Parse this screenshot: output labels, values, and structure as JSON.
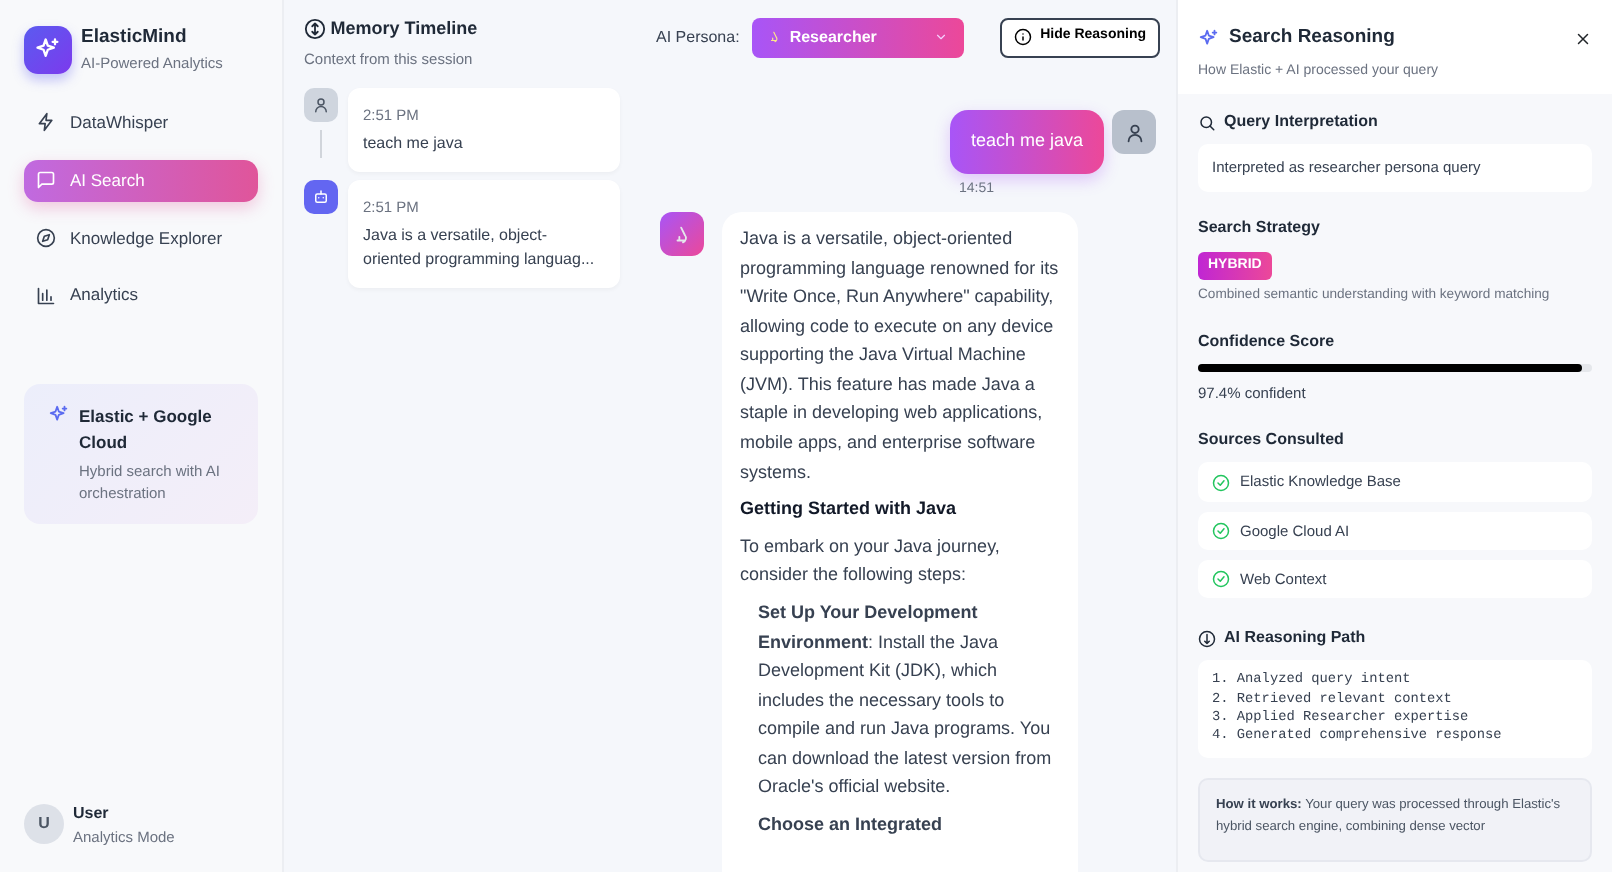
{
  "brand": {
    "name": "ElasticMind",
    "subtitle": "AI-Powered Analytics"
  },
  "nav": [
    {
      "label": "DataWhisper",
      "selected": false
    },
    {
      "label": "AI Search",
      "selected": true
    },
    {
      "label": "Knowledge Explorer",
      "selected": false
    },
    {
      "label": "Analytics",
      "selected": false
    }
  ],
  "promo": {
    "title": "Elastic + Google Cloud",
    "text": "Hybrid search with AI orchestration"
  },
  "user": {
    "initial": "U",
    "name": "User",
    "mode": "Analytics Mode"
  },
  "memory": {
    "title": "Memory Timeline",
    "subtitle": "Context from this session",
    "entries": [
      {
        "kind": "user",
        "time": "2:51 PM",
        "text": "teach me java"
      },
      {
        "kind": "assistant",
        "time": "2:51 PM",
        "text": "Java is a versatile, object-oriented programming languag..."
      }
    ]
  },
  "chat_header": {
    "persona_label": "AI Persona:",
    "persona_value": "Researcher",
    "hide_button": "Hide Reasoning"
  },
  "user_message": {
    "text": "teach me java",
    "time": "14:51"
  },
  "assistant_message": {
    "blocks": [
      {
        "kind": "p",
        "text": "Java is a versatile, object-oriented programming language renowned for its \"Write Once, Run Anywhere\" capability, allowing code to execute on any device supporting the Java Virtual Machine (JVM). This feature has made Java a staple in developing web applications, mobile apps, and enterprise software systems."
      },
      {
        "kind": "h",
        "text": "Getting Started with Java"
      },
      {
        "kind": "p",
        "text": "To embark on your Java journey, consider the following steps:"
      },
      {
        "kind": "li",
        "text": "**Set Up Your Development Environment**: Install the Java Development Kit (JDK), which includes the necessary tools to compile and run Java programs. You can download the latest version from Oracle's official website."
      },
      {
        "kind": "lih",
        "text": "Choose an Integrated"
      }
    ]
  },
  "reasoning": {
    "title": "Search Reasoning",
    "subtitle": "How Elastic + AI processed your query",
    "query_title": "Query Interpretation",
    "query_text": "Interpreted as researcher persona query",
    "strategy_title": "Search Strategy",
    "strategy_badge": "HYBRID",
    "strategy_text": "Combined semantic understanding with keyword matching",
    "confidence_title": "Confidence Score",
    "confidence": {
      "level": 0.974
    },
    "confidence_text": "97.4% confident",
    "sources_title": "Sources Consulted",
    "sources": [
      {
        "label": "Elastic Knowledge Base",
        "checked": true
      },
      {
        "label": "Google Cloud AI",
        "checked": true
      },
      {
        "label": "Web Context",
        "checked": true
      }
    ],
    "path_title": "AI Reasoning Path",
    "path": [
      "1. Analyzed query intent",
      "2. Retrieved relevant context",
      "3. Applied Researcher expertise",
      "4. Generated comprehensive response"
    ],
    "how_it_works": "**How it works:** Your query was processed through Elastic's hybrid search engine, combining dense vector"
  }
}
